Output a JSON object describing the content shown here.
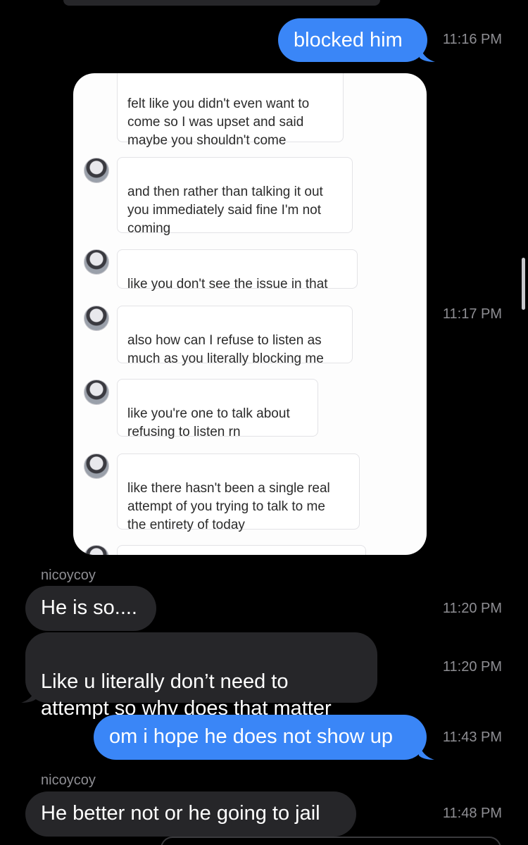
{
  "messages": [
    {
      "id": "m1",
      "text": "blocked him",
      "time": "11:16 PM"
    },
    {
      "id": "m2",
      "time": "11:17 PM"
    },
    {
      "id": "m3",
      "sender": "nicoycoy",
      "text": "He is so....",
      "time": "11:20 PM"
    },
    {
      "id": "m4",
      "text": "Like u literally don’t need to\nattempt so why does that matter",
      "time": "11:20 PM"
    },
    {
      "id": "m5",
      "text": "om i hope he does not show up",
      "time": "11:43 PM"
    },
    {
      "id": "m6",
      "sender": "nicoycoy",
      "text": "He better not or he going to jail",
      "time": "11:48 PM"
    }
  ],
  "embedded_screenshot": {
    "messages": [
      "felt like you didn't even want to\ncome so I was upset and said\nmaybe you shouldn't come",
      "and then rather than talking it out\nyou immediately said fine I'm not\ncoming",
      "like you don't see the issue in that",
      "also how can I refuse to listen as\nmuch as you literally blocking me",
      "like you're one to talk about\nrefusing to listen rn",
      "like there hasn't been a single real\nattempt of you trying to talk to me\nthe entirety of today"
    ]
  },
  "colors": {
    "background": "#000000",
    "sent_bubble": "#3a86f7",
    "received_bubble": "#262629",
    "timestamp": "#8e8e93"
  }
}
